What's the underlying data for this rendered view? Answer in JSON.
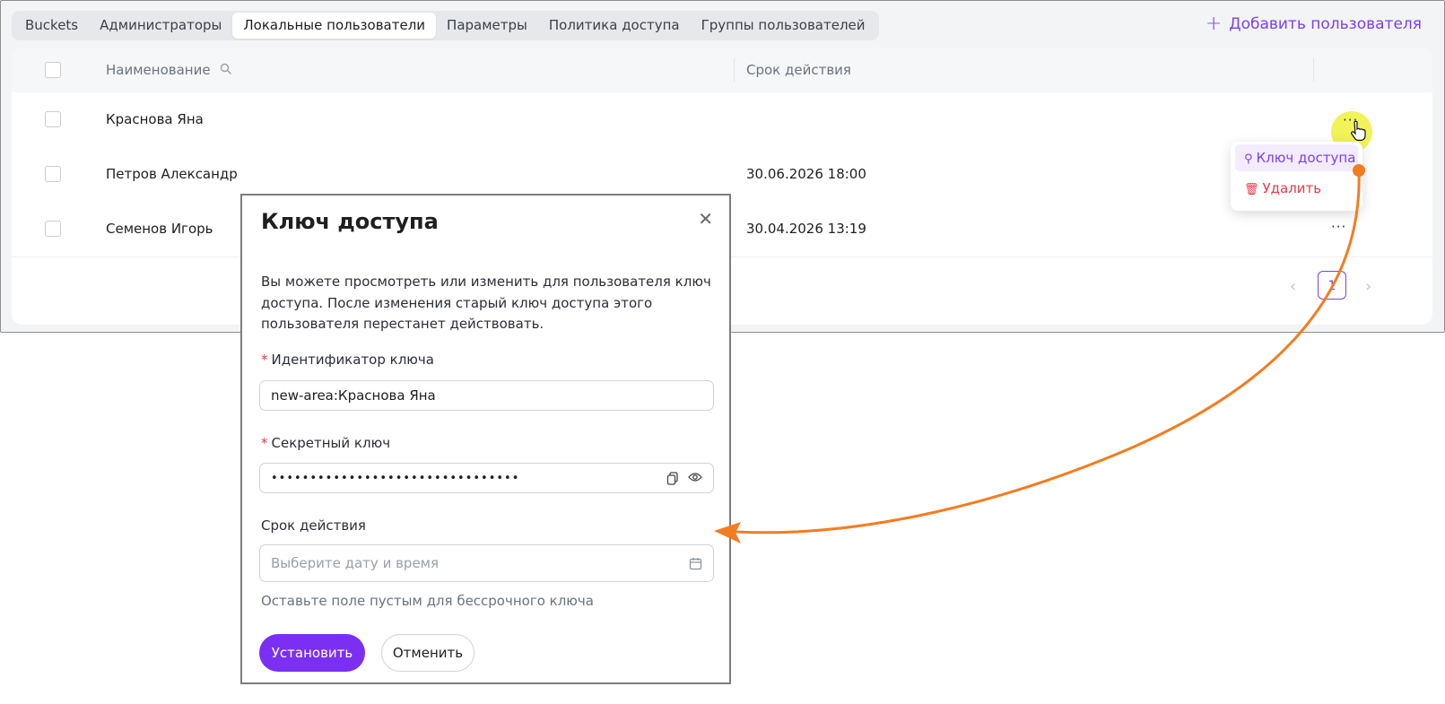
{
  "tabs": [
    {
      "label": "Buckets"
    },
    {
      "label": "Администраторы"
    },
    {
      "label": "Локальные пользователи"
    },
    {
      "label": "Параметры"
    },
    {
      "label": "Политика доступа"
    },
    {
      "label": "Группы пользователей"
    }
  ],
  "header": {
    "add_user_label": "Добавить пользователя",
    "add_icon": "plus-icon"
  },
  "table": {
    "columns": {
      "name": "Наименование",
      "expiry": "Срок действия"
    },
    "rows": [
      {
        "name": "Краснова Яна",
        "expiry": ""
      },
      {
        "name": "Петров Александр",
        "expiry": "30.06.2026 18:00"
      },
      {
        "name": "Семенов Игорь",
        "expiry": "30.04.2026 13:19"
      }
    ],
    "row_actions": "···"
  },
  "pagination": {
    "current": "1"
  },
  "context_menu": {
    "access_key": "Ключ доступа",
    "delete": "Удалить"
  },
  "modal": {
    "title": "Ключ доступа",
    "description": "Вы можете просмотреть или изменить для пользователя ключ доступа. После изменения старый ключ доступа этого пользователя перестанет действовать.",
    "key_id_label": "Идентификатор ключа",
    "key_id_value": "new-area:Краснова Яна",
    "secret_label": "Секретный ключ",
    "secret_value": "••••••••••••••••••••••••••••••••",
    "expiry_label": "Срок действия",
    "expiry_placeholder": "Выберите дату и время",
    "expiry_hint": "Оставьте поле пустым для бессрочного ключа",
    "submit": "Установить",
    "cancel": "Отменить"
  },
  "colors": {
    "accent": "#7b2ff2",
    "danger": "#e53945",
    "annotation": "#f47c20",
    "cursor_highlight": "#f0f03c"
  }
}
